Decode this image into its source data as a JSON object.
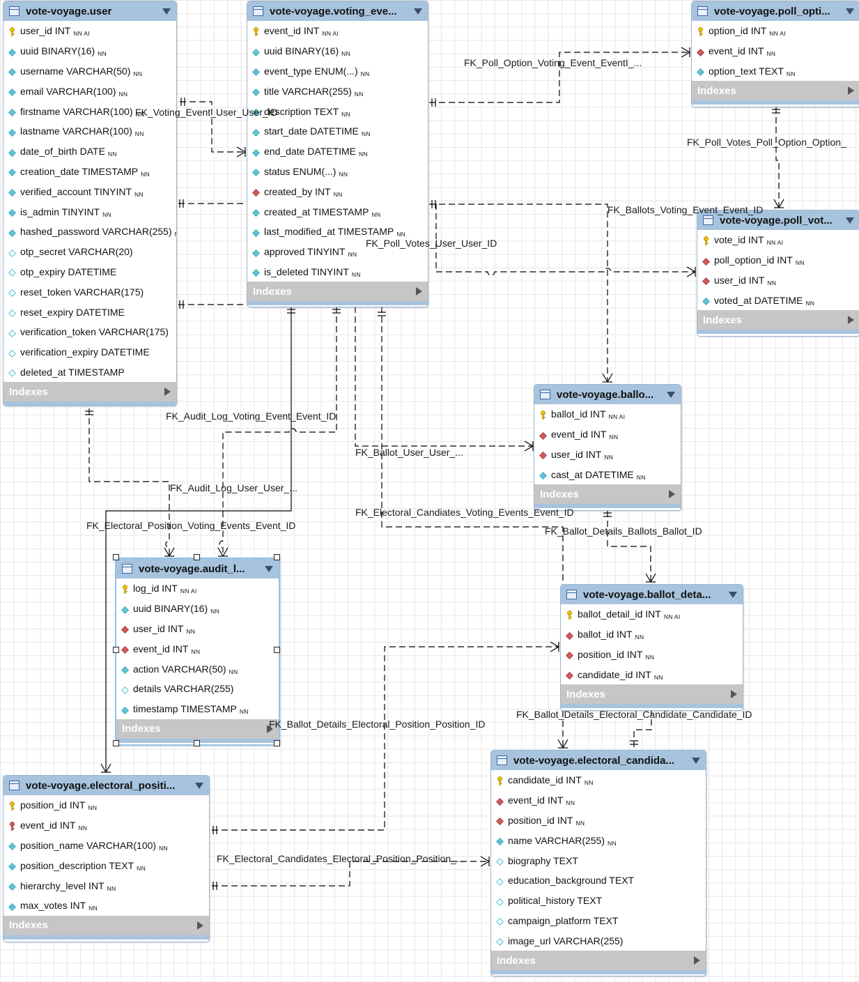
{
  "entities": [
    {
      "id": "user",
      "title": "vote-voyage.user",
      "columns": [
        {
          "name": "user_id INT",
          "flags": "NN AI",
          "icon": "key"
        },
        {
          "name": "uuid BINARY(16)",
          "flags": "NN",
          "icon": "diamond-filled"
        },
        {
          "name": "username VARCHAR(50)",
          "flags": "NN",
          "icon": "diamond-filled"
        },
        {
          "name": "email VARCHAR(100)",
          "flags": "NN",
          "icon": "diamond-filled"
        },
        {
          "name": "firstname VARCHAR(100)",
          "flags": "NN",
          "icon": "diamond-filled"
        },
        {
          "name": "lastname VARCHAR(100)",
          "flags": "NN",
          "icon": "diamond-filled"
        },
        {
          "name": "date_of_birth DATE",
          "flags": "NN",
          "icon": "diamond-filled"
        },
        {
          "name": "creation_date TIMESTAMP",
          "flags": "NN",
          "icon": "diamond-filled"
        },
        {
          "name": "verified_account TINYINT",
          "flags": "NN",
          "icon": "diamond-filled"
        },
        {
          "name": "is_admin TINYINT",
          "flags": "NN",
          "icon": "diamond-filled"
        },
        {
          "name": "hashed_password VARCHAR(255)",
          "flags": "NN",
          "icon": "diamond-filled"
        },
        {
          "name": "otp_secret VARCHAR(20)",
          "flags": "",
          "icon": "diamond-open"
        },
        {
          "name": "otp_expiry DATETIME",
          "flags": "",
          "icon": "diamond-open"
        },
        {
          "name": "reset_token VARCHAR(175)",
          "flags": "",
          "icon": "diamond-open"
        },
        {
          "name": "reset_expiry DATETIME",
          "flags": "",
          "icon": "diamond-open"
        },
        {
          "name": "verification_token VARCHAR(175)",
          "flags": "",
          "icon": "diamond-open"
        },
        {
          "name": "verification_expiry DATETIME",
          "flags": "",
          "icon": "diamond-open"
        },
        {
          "name": "deleted_at TIMESTAMP",
          "flags": "",
          "icon": "diamond-open"
        }
      ],
      "indexes_label": "Indexes",
      "selected": false
    },
    {
      "id": "voting_events",
      "title": "vote-voyage.voting_eve...",
      "columns": [
        {
          "name": "event_id INT",
          "flags": "NN AI",
          "icon": "key"
        },
        {
          "name": "uuid BINARY(16)",
          "flags": "NN",
          "icon": "diamond-filled"
        },
        {
          "name": "event_type ENUM(...)",
          "flags": "NN",
          "icon": "diamond-filled"
        },
        {
          "name": "title VARCHAR(255)",
          "flags": "NN",
          "icon": "diamond-filled"
        },
        {
          "name": "description TEXT",
          "flags": "NN",
          "icon": "diamond-filled"
        },
        {
          "name": "start_date DATETIME",
          "flags": "NN",
          "icon": "diamond-filled"
        },
        {
          "name": "end_date DATETIME",
          "flags": "NN",
          "icon": "diamond-filled"
        },
        {
          "name": "status ENUM(...)",
          "flags": "NN",
          "icon": "diamond-filled"
        },
        {
          "name": "created_by INT",
          "flags": "NN",
          "icon": "fk"
        },
        {
          "name": "created_at TIMESTAMP",
          "flags": "NN",
          "icon": "diamond-filled"
        },
        {
          "name": "last_modified_at TIMESTAMP",
          "flags": "NN",
          "icon": "diamond-filled"
        },
        {
          "name": "approved TINYINT",
          "flags": "NN",
          "icon": "diamond-filled"
        },
        {
          "name": "is_deleted TINYINT",
          "flags": "NN",
          "icon": "diamond-filled"
        }
      ],
      "indexes_label": "Indexes",
      "selected": false
    },
    {
      "id": "poll_options",
      "title": "vote-voyage.poll_opti...",
      "columns": [
        {
          "name": "option_id INT",
          "flags": "NN AI",
          "icon": "key"
        },
        {
          "name": "event_id INT",
          "flags": "NN",
          "icon": "fk"
        },
        {
          "name": "option_text TEXT",
          "flags": "NN",
          "icon": "diamond-filled"
        }
      ],
      "indexes_label": "Indexes",
      "selected": false
    },
    {
      "id": "poll_votes",
      "title": "vote-voyage.poll_vot...",
      "columns": [
        {
          "name": "vote_id INT",
          "flags": "NN AI",
          "icon": "key"
        },
        {
          "name": "poll_option_id INT",
          "flags": "NN",
          "icon": "fk"
        },
        {
          "name": "user_id INT",
          "flags": "NN",
          "icon": "fk"
        },
        {
          "name": "voted_at DATETIME",
          "flags": "NN",
          "icon": "diamond-filled"
        }
      ],
      "indexes_label": "Indexes",
      "selected": false
    },
    {
      "id": "ballots",
      "title": "vote-voyage.ballo...",
      "columns": [
        {
          "name": "ballot_id INT",
          "flags": "NN AI",
          "icon": "key"
        },
        {
          "name": "event_id INT",
          "flags": "NN",
          "icon": "fk"
        },
        {
          "name": "user_id INT",
          "flags": "NN",
          "icon": "fk"
        },
        {
          "name": "cast_at DATETIME",
          "flags": "NN",
          "icon": "diamond-filled"
        }
      ],
      "indexes_label": "Indexes",
      "selected": false
    },
    {
      "id": "audit_log",
      "title": "vote-voyage.audit_l...",
      "columns": [
        {
          "name": "log_id INT",
          "flags": "NN AI",
          "icon": "key"
        },
        {
          "name": "uuid BINARY(16)",
          "flags": "NN",
          "icon": "diamond-filled"
        },
        {
          "name": "user_id INT",
          "flags": "NN",
          "icon": "fk"
        },
        {
          "name": "event_id INT",
          "flags": "NN",
          "icon": "fk"
        },
        {
          "name": "action VARCHAR(50)",
          "flags": "NN",
          "icon": "diamond-filled"
        },
        {
          "name": "details VARCHAR(255)",
          "flags": "",
          "icon": "diamond-open"
        },
        {
          "name": "timestamp TIMESTAMP",
          "flags": "NN",
          "icon": "diamond-filled"
        }
      ],
      "indexes_label": "Indexes",
      "selected": true
    },
    {
      "id": "ballot_details",
      "title": "vote-voyage.ballot_deta...",
      "columns": [
        {
          "name": "ballot_detail_id INT",
          "flags": "NN AI",
          "icon": "key"
        },
        {
          "name": "ballot_id INT",
          "flags": "NN",
          "icon": "fk"
        },
        {
          "name": "position_id INT",
          "flags": "NN",
          "icon": "fk"
        },
        {
          "name": "candidate_id INT",
          "flags": "NN",
          "icon": "fk"
        }
      ],
      "indexes_label": "Indexes",
      "selected": false
    },
    {
      "id": "electoral_positions",
      "title": "vote-voyage.electoral_positi...",
      "columns": [
        {
          "name": "position_id INT",
          "flags": "NN",
          "icon": "key"
        },
        {
          "name": "event_id INT",
          "flags": "NN",
          "icon": "key-red"
        },
        {
          "name": "position_name VARCHAR(100)",
          "flags": "NN",
          "icon": "diamond-filled"
        },
        {
          "name": "position_description TEXT",
          "flags": "NN",
          "icon": "diamond-filled"
        },
        {
          "name": "hierarchy_level INT",
          "flags": "NN",
          "icon": "diamond-filled"
        },
        {
          "name": "max_votes INT",
          "flags": "NN",
          "icon": "diamond-filled"
        }
      ],
      "indexes_label": "Indexes",
      "selected": false
    },
    {
      "id": "electoral_candidates",
      "title": "vote-voyage.electoral_candida...",
      "columns": [
        {
          "name": "candidate_id INT",
          "flags": "NN",
          "icon": "key"
        },
        {
          "name": "event_id INT",
          "flags": "NN",
          "icon": "fk"
        },
        {
          "name": "position_id INT",
          "flags": "NN",
          "icon": "fk"
        },
        {
          "name": "name VARCHAR(255)",
          "flags": "NN",
          "icon": "diamond-filled"
        },
        {
          "name": "biography TEXT",
          "flags": "",
          "icon": "diamond-open"
        },
        {
          "name": "education_background TEXT",
          "flags": "",
          "icon": "diamond-open"
        },
        {
          "name": "political_history TEXT",
          "flags": "",
          "icon": "diamond-open"
        },
        {
          "name": "campaign_platform TEXT",
          "flags": "",
          "icon": "diamond-open"
        },
        {
          "name": "image_url VARCHAR(255)",
          "flags": "",
          "icon": "diamond-open"
        }
      ],
      "indexes_label": "Indexes",
      "selected": false
    }
  ],
  "relationships": [
    {
      "id": "poll_option_event",
      "label": "FK_Poll_Option_Voting_Event_EventI_..."
    },
    {
      "id": "voting_event_user",
      "label": "FK_Voting_Event_User_User_ID"
    },
    {
      "id": "poll_votes_option",
      "label": "FK_Poll_Votes_Poll_Option_Option_"
    },
    {
      "id": "ballots_event",
      "label": "FK_Ballots_Voting_Event_Event_ID"
    },
    {
      "id": "poll_votes_user",
      "label": "FK_Poll_Votes_User_User_ID"
    },
    {
      "id": "audit_event",
      "label": "FK_Audit_Log_Voting_Event_Event_ID"
    },
    {
      "id": "ballot_user",
      "label": "FK_Ballot_User_User_..."
    },
    {
      "id": "audit_user",
      "label": "FK_Audit_Log_User_User_..."
    },
    {
      "id": "candidates_event",
      "label": "FK_Electoral_Candiates_Voting_Events_Event_ID"
    },
    {
      "id": "position_event",
      "label": "FK_Electoral_Position_Voting_Events_Event_ID"
    },
    {
      "id": "details_ballots",
      "label": "FK_Ballot_Details_Ballots_Ballot_ID"
    },
    {
      "id": "details_position",
      "label": "FK_Ballot_Details_Electoral_Position_Position_ID"
    },
    {
      "id": "details_candidate",
      "label": "FK_Ballot_Details_Electoral_Candidate_Candidate_ID"
    },
    {
      "id": "candidates_position",
      "label": "FK_Electoral_Candidates_Electoral_Position_Position_..."
    }
  ],
  "colors": {
    "header": "#a7c3dd",
    "footer": "#c6c6c6",
    "key": "#f2c200",
    "fk": "#d45a5a",
    "column": "#5ec3d6",
    "grid": "#e6e6e6"
  }
}
